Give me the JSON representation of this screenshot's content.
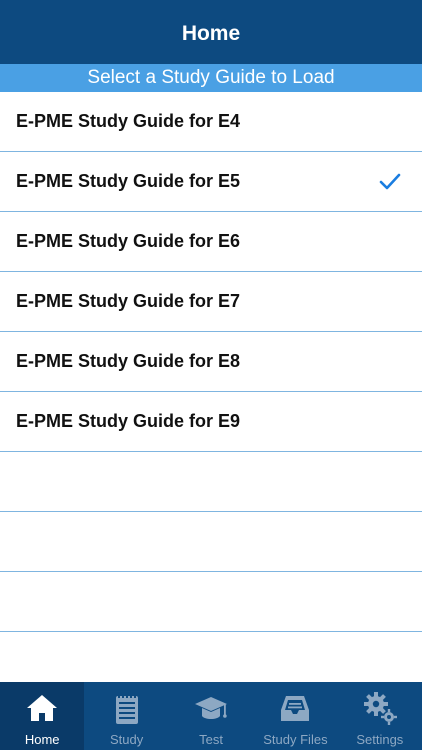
{
  "header": {
    "title": "Home"
  },
  "section": {
    "title": "Select a Study Guide to Load"
  },
  "guides": [
    {
      "label": "E-PME Study Guide for E4",
      "selected": false
    },
    {
      "label": "E-PME Study Guide for E5",
      "selected": true
    },
    {
      "label": "E-PME Study Guide for E6",
      "selected": false
    },
    {
      "label": "E-PME Study Guide for E7",
      "selected": false
    },
    {
      "label": "E-PME Study Guide for E8",
      "selected": false
    },
    {
      "label": "E-PME Study Guide for E9",
      "selected": false
    }
  ],
  "tabs": [
    {
      "label": "Home",
      "icon": "home-icon",
      "active": true
    },
    {
      "label": "Study",
      "icon": "notepad-icon",
      "active": false
    },
    {
      "label": "Test",
      "icon": "graduation-cap-icon",
      "active": false
    },
    {
      "label": "Study Files",
      "icon": "inbox-tray-icon",
      "active": false
    },
    {
      "label": "Settings",
      "icon": "gears-icon",
      "active": false
    }
  ],
  "colors": {
    "nav_bar": "#0d4a80",
    "section_header": "#4aa0e4",
    "checkmark": "#1a7de0",
    "divider": "#7fb5e0"
  }
}
